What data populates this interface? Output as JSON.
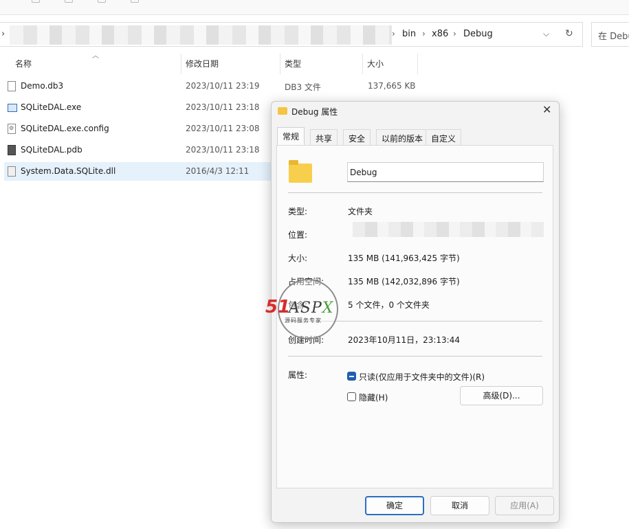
{
  "address": {
    "crumbs": [
      "bin",
      "x86",
      "Debug"
    ],
    "search_placeholder": "在 Debug"
  },
  "columns": {
    "name": "名称",
    "date": "修改日期",
    "type": "类型",
    "size": "大小"
  },
  "files": [
    {
      "name": "Demo.db3",
      "date": "2023/10/11 23:19",
      "type": "DB3 文件",
      "size": "137,665 KB",
      "icon": "file-icon"
    },
    {
      "name": "SQLiteDAL.exe",
      "date": "2023/10/11 23:18",
      "type": "",
      "size": "",
      "icon": "exe-icon"
    },
    {
      "name": "SQLiteDAL.exe.config",
      "date": "2023/10/11 23:08",
      "type": "",
      "size": "",
      "icon": "config-icon"
    },
    {
      "name": "SQLiteDAL.pdb",
      "date": "2023/10/11 23:18",
      "type": "",
      "size": "",
      "icon": "pdb-icon"
    },
    {
      "name": "System.Data.SQLite.dll",
      "date": "2016/4/3 12:11",
      "type": "",
      "size": "",
      "icon": "dll-icon"
    }
  ],
  "dialog": {
    "title": "Debug 属性",
    "close": "✕",
    "tabs": [
      "常规",
      "共享",
      "安全",
      "以前的版本",
      "自定义"
    ],
    "folder_name": "Debug",
    "type_label": "类型:",
    "type_value": "文件夹",
    "location_label": "位置:",
    "size_label": "大小:",
    "size_value": "135 MB (141,963,425 字节)",
    "disk_size_label": "占用空间:",
    "disk_size_value": "135 MB (142,032,896 字节)",
    "contains_label": "包含:",
    "contains_value": "5 个文件，0 个文件夹",
    "created_label": "创建时间:",
    "created_value": "2023年10月11日，23:13:44",
    "attributes_label": "属性:",
    "readonly_label": "只读(仅应用于文件夹中的文件)(R)",
    "hidden_label": "隐藏(H)",
    "advanced_button": "高级(D)...",
    "ok_button": "确定",
    "cancel_button": "取消",
    "apply_button": "应用(A)"
  },
  "watermark": {
    "brand_num": "51",
    "brand_text": "ASP",
    "brand_x": "X",
    "subtitle": "源码服务专家"
  }
}
